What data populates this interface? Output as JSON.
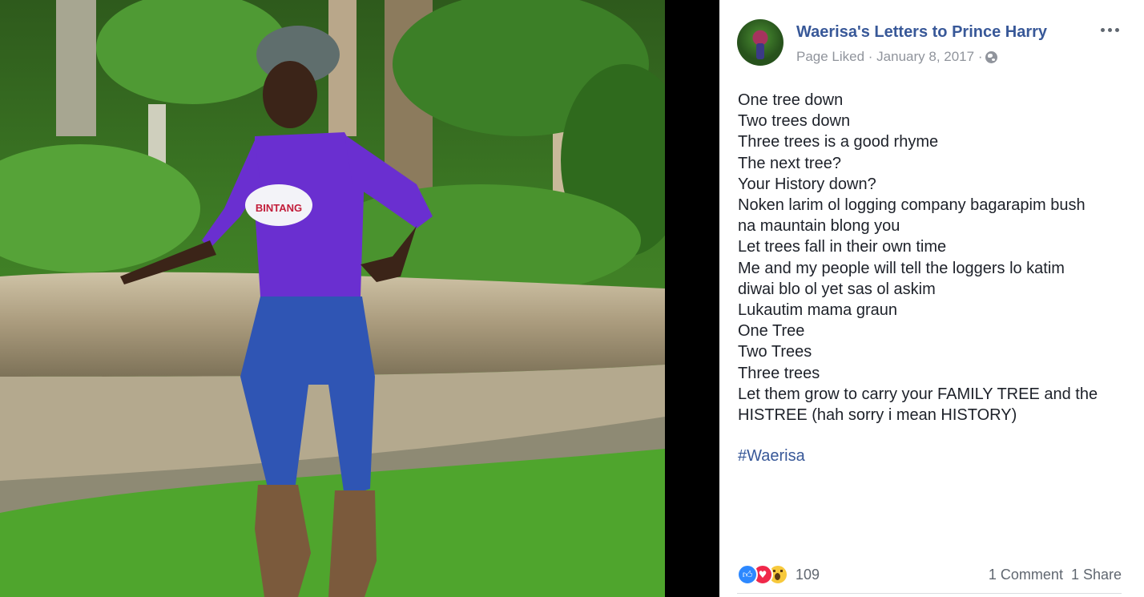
{
  "post": {
    "page_name": "Waerisa's Letters to Prince Harry",
    "meta_text": "Page Liked · January 8, 2017 ·",
    "privacy_icon": "globe-icon",
    "more_icon": "more-options-icon",
    "body_lines": [
      "One tree down",
      "Two trees down",
      "Three trees is a good rhyme",
      "The next tree?",
      "Your History down?",
      "Noken larim ol logging company bagarapim bush",
      "na mauntain blong you",
      "Let trees fall in their own time",
      "Me and my people will tell the loggers lo katim",
      "diwai blo ol yet sas ol askim",
      "Lukautim mama graun",
      "One Tree",
      "Two Trees",
      "Three trees",
      "Let them grow to carry your FAMILY TREE and the",
      "HISTREE (hah sorry i mean HISTORY)"
    ],
    "hashtag": "#Waerisa"
  },
  "footer": {
    "reaction_icons": [
      "like-icon",
      "love-icon",
      "wow-icon"
    ],
    "reaction_count": "109",
    "comments": "1 Comment",
    "shares": "1 Share"
  },
  "photo": {
    "shirt_text": "BINTANG",
    "colors": {
      "foliage": "#3f8a25",
      "shirt": "#6a2fd0",
      "jeans": "#2f55b4",
      "log": "#b8a88a"
    }
  },
  "colors": {
    "link": "#385898",
    "text": "#1d2129",
    "muted": "#90949c"
  }
}
